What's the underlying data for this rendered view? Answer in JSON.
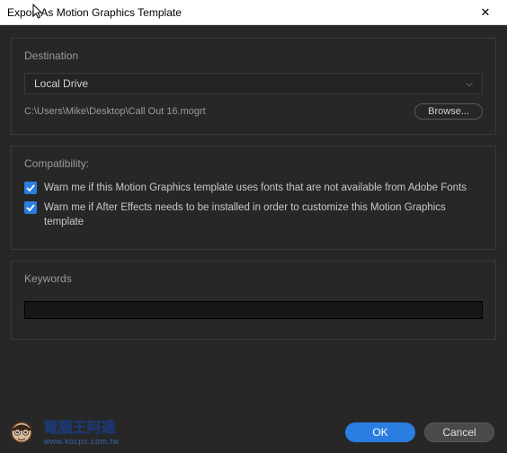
{
  "title": "Export As Motion Graphics Template",
  "destination": {
    "label": "Destination",
    "selected": "Local Drive",
    "path": "C:\\Users\\Mike\\Desktop\\Call Out 16.mogrt",
    "browse_label": "Browse..."
  },
  "compatibility": {
    "label": "Compatibility:",
    "warn_fonts": "Warn me if this Motion Graphics template uses fonts that are not available from Adobe Fonts",
    "warn_ae": "Warn me if After Effects needs to be installed in order to customize this Motion Graphics template"
  },
  "keywords": {
    "label": "Keywords",
    "value": ""
  },
  "buttons": {
    "ok": "OK",
    "cancel": "Cancel"
  },
  "watermark": {
    "line1": "電腦王阿達",
    "line2": "www.kocpc.com.tw"
  }
}
